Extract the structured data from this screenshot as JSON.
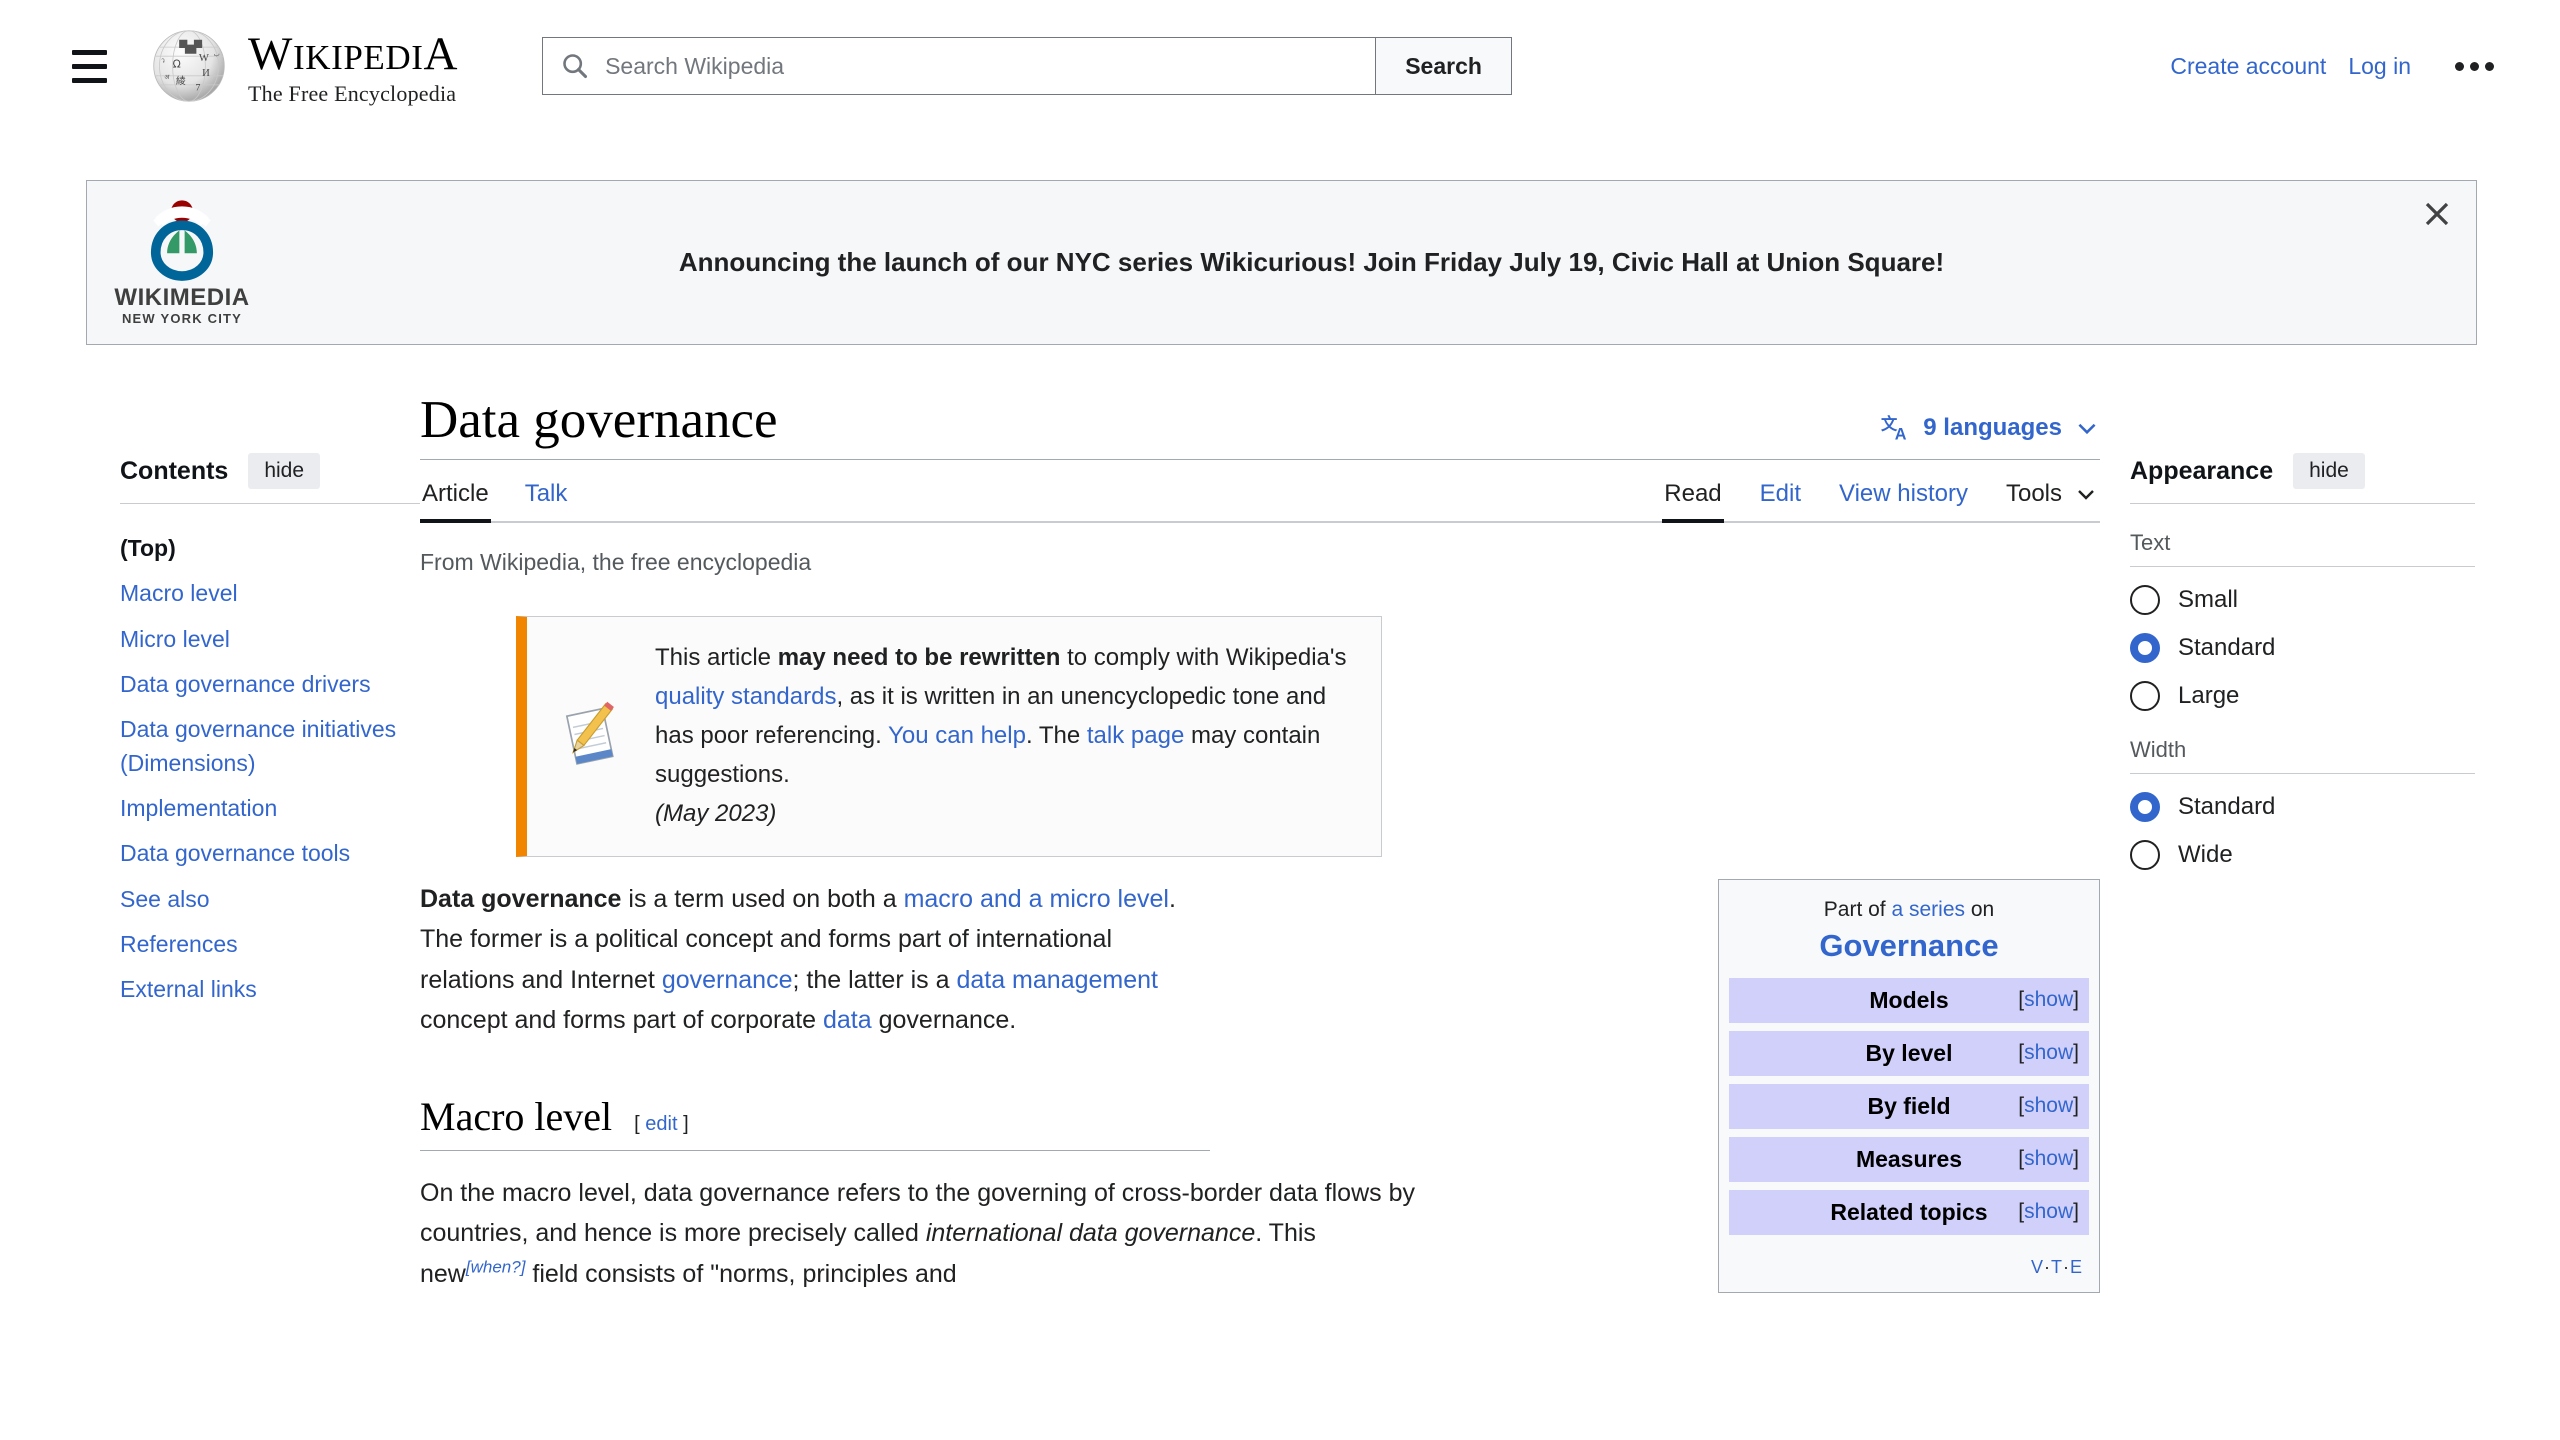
{
  "header": {
    "menu_icon": "hamburger-icon",
    "logo": {
      "wordmark_parts": [
        "W",
        "IKIPEDI",
        "A"
      ],
      "wordmark": "WIKIPEDIA",
      "tagline": "The Free Encyclopedia"
    },
    "search": {
      "placeholder": "Search Wikipedia",
      "value": "",
      "button_label": "Search",
      "icon": "search-icon"
    },
    "create_account": "Create account",
    "log_in": "Log in",
    "more_icon": "ellipsis-icon"
  },
  "banner": {
    "org_line1": "WIKIMEDIA",
    "org_line2": "NEW YORK CITY",
    "message": "Announcing the launch of our NYC series Wikicurious! Join Friday July 19, Civic Hall at Union Square!",
    "close_icon": "close-icon"
  },
  "toc": {
    "heading": "Contents",
    "hide_label": "hide",
    "items": [
      {
        "label": "(Top)",
        "active": true
      },
      {
        "label": "Macro level"
      },
      {
        "label": "Micro level"
      },
      {
        "label": "Data governance drivers"
      },
      {
        "label": "Data governance initiatives (Dimensions)"
      },
      {
        "label": "Implementation"
      },
      {
        "label": "Data governance tools"
      },
      {
        "label": "See also"
      },
      {
        "label": "References"
      },
      {
        "label": "External links"
      }
    ]
  },
  "article": {
    "title": "Data governance",
    "languages": {
      "icon": "language-icon",
      "label": "9 languages",
      "chevron": "chevron-down-icon"
    },
    "tabs_left": [
      {
        "label": "Article",
        "selected": true
      },
      {
        "label": "Talk",
        "selected": false
      }
    ],
    "tabs_right": [
      {
        "label": "Read",
        "selected": true
      },
      {
        "label": "Edit",
        "selected": false
      },
      {
        "label": "View history",
        "selected": false
      }
    ],
    "tools_label": "Tools",
    "tools_chevron": "chevron-down-icon",
    "site_sub": "From Wikipedia, the free encyclopedia",
    "notice": {
      "icon": "notepad-pencil-icon",
      "t1": "This article ",
      "bold": "may need to be rewritten",
      "t2": " to comply with Wikipedia's ",
      "link1": "quality standards",
      "t3": ", as it is written in an unencyclopedic tone and has poor referencing. ",
      "link2": "You can help",
      "t4": ". The ",
      "link3": "talk page",
      "t5": " may contain suggestions.",
      "date": "(May 2023)"
    },
    "lead": {
      "bold_term": "Data governance",
      "p1": " is a term used on both a ",
      "link_macro": "macro and a micro level",
      "p2": ". The former is a political concept and forms part of international relations and Internet ",
      "link_gov": "governance",
      "p3": "; the latter is a ",
      "link_dm": "data management",
      "p4": " concept and forms part of corporate ",
      "link_data": "data",
      "p5": " governance."
    },
    "section1": {
      "heading": "Macro level",
      "edit_open": "[",
      "edit_label": "edit",
      "edit_close": "]",
      "p1a": "On the macro level, data governance refers to the governing of cross-border data flows by countries, and hence is more precisely called ",
      "p1_italic": "international data governance",
      "p1b": ". This new",
      "when_tag": "[when?]",
      "p1c": " field consists of \"norms, principles and"
    }
  },
  "infobox": {
    "part_of_pre": "Part of ",
    "part_of_link": "a series",
    "part_of_post": " on",
    "title": "Governance",
    "rows": [
      {
        "label": "Models",
        "show": "show"
      },
      {
        "label": "By level",
        "show": "show"
      },
      {
        "label": "By field",
        "show": "show"
      },
      {
        "label": "Measures",
        "show": "show"
      },
      {
        "label": "Related topics",
        "show": "show"
      }
    ],
    "footer": {
      "v": "V",
      "t": "T",
      "e": "E",
      "dot": "·"
    }
  },
  "appearance": {
    "heading": "Appearance",
    "hide_label": "hide",
    "text_group_label": "Text",
    "text_options": [
      {
        "label": "Small",
        "selected": false
      },
      {
        "label": "Standard",
        "selected": true
      },
      {
        "label": "Large",
        "selected": false
      }
    ],
    "width_group_label": "Width",
    "width_options": [
      {
        "label": "Standard",
        "selected": true
      },
      {
        "label": "Wide",
        "selected": false
      }
    ]
  },
  "colors": {
    "link": "#3366cc",
    "text": "#202122",
    "infobox_row": "#d0d0fa",
    "ambox_border": "#f28500",
    "radio_on": "#3366cc"
  }
}
